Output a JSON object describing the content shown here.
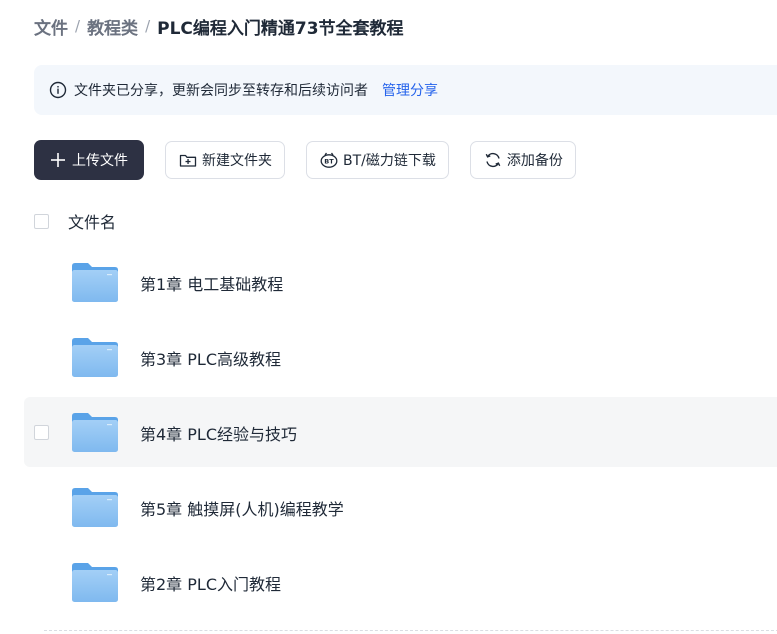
{
  "breadcrumb": {
    "items": [
      "文件",
      "教程类"
    ],
    "separator": "/",
    "current": "PLC编程入门精通73节全套教程"
  },
  "notice": {
    "icon": "info-icon",
    "text": "文件夹已分享，更新会同步至转存和后续访问者",
    "link": "管理分享"
  },
  "toolbar": {
    "upload": "上传文件",
    "new_folder": "新建文件夹",
    "bt_download": "BT/磁力链下载",
    "add_backup": "添加备份"
  },
  "list": {
    "header": "文件名",
    "rows": [
      {
        "name": "第1章 电工基础教程"
      },
      {
        "name": "第3章 PLC高级教程"
      },
      {
        "name": "第4章 PLC经验与技巧"
      },
      {
        "name": "第5章 触摸屏(人机)编程教学"
      },
      {
        "name": "第2章 PLC入门教程"
      }
    ]
  },
  "colors": {
    "accent": "#2563eb",
    "primary_button": "#2d3143",
    "folder": "#7cb7f0",
    "notice_bg": "#f3f7fc"
  }
}
